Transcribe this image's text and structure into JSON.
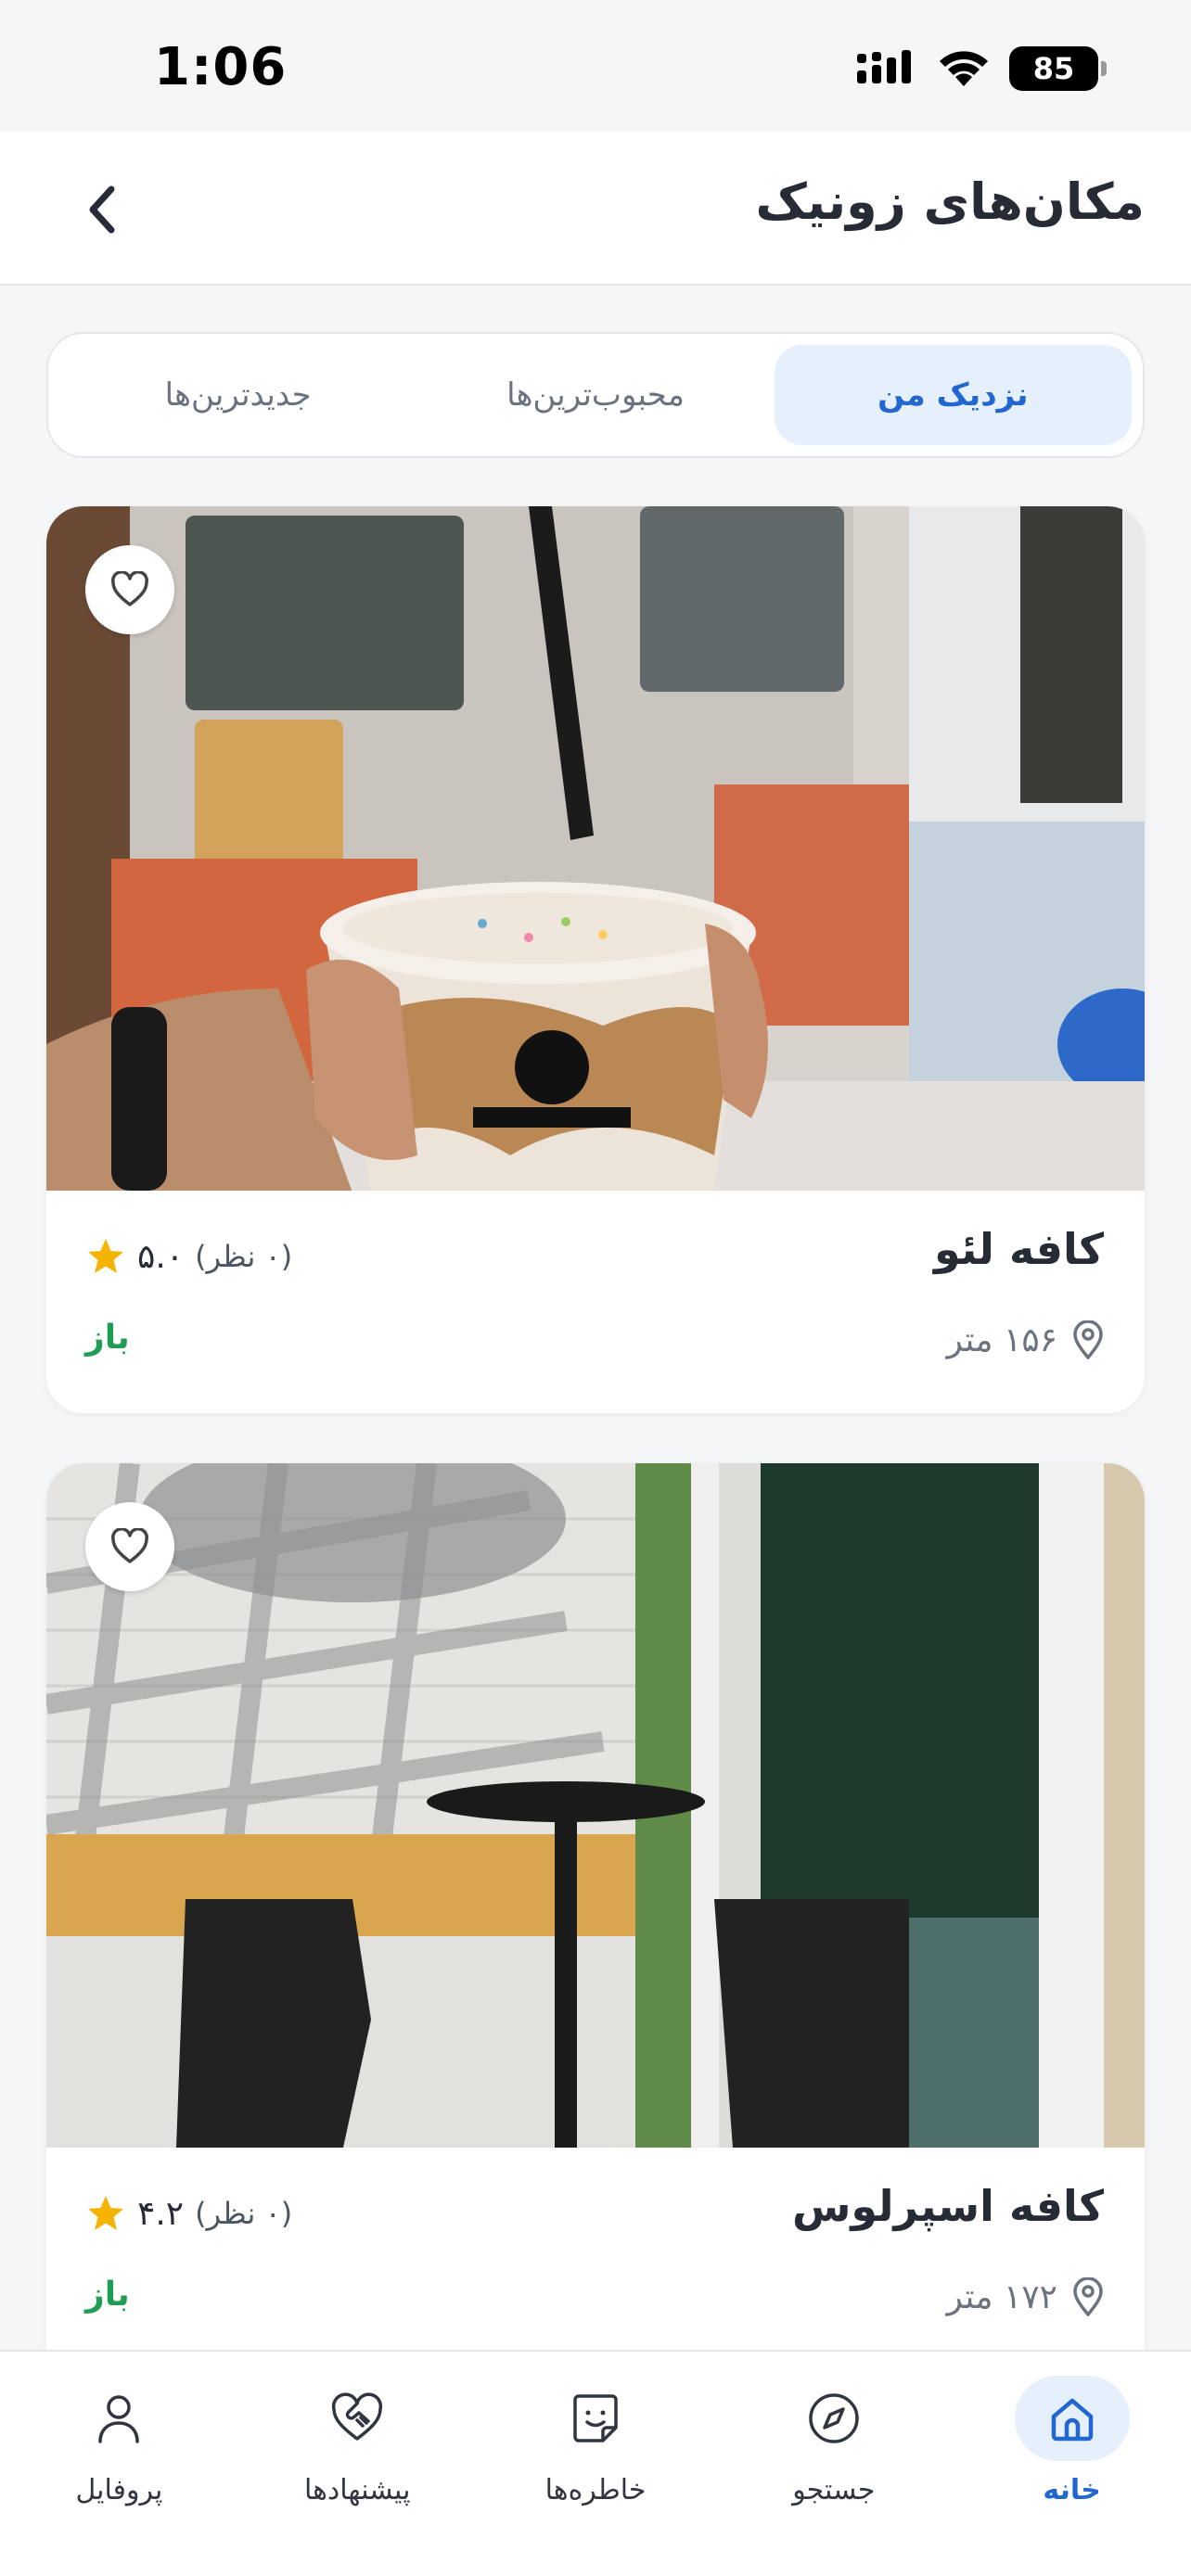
{
  "status_bar": {
    "time": "1:06",
    "battery": "85"
  },
  "header": {
    "title": "مکان‌های زونیک"
  },
  "tabs": [
    {
      "label": "نزدیک من",
      "active": true
    },
    {
      "label": "محبوب‌ترین‌ها",
      "active": false
    },
    {
      "label": "جدیدترین‌ها",
      "active": false
    }
  ],
  "places": [
    {
      "name": "کافه لئو",
      "rating": "۵.۰",
      "reviews": "(۰ نظر)",
      "distance": "۱۵۶ متر",
      "status": "باز"
    },
    {
      "name": "کافه اسپرلوس",
      "rating": "۴.۲",
      "reviews": "(۰ نظر)",
      "distance": "۱۷۲ متر",
      "status": "باز"
    }
  ],
  "bottom_nav": [
    {
      "label": "خانه",
      "icon": "home-icon",
      "active": true
    },
    {
      "label": "جستجو",
      "icon": "compass-icon",
      "active": false
    },
    {
      "label": "خاطره‌ها",
      "icon": "memory-note-icon",
      "active": false
    },
    {
      "label": "پیشنهادها",
      "icon": "heart-handshake-icon",
      "active": false
    },
    {
      "label": "پروفایل",
      "icon": "user-icon",
      "active": false
    }
  ],
  "colors": {
    "accent": "#2166d1",
    "accent_bg": "#e6effc",
    "open": "#1f9d55",
    "star": "#f5b301"
  }
}
